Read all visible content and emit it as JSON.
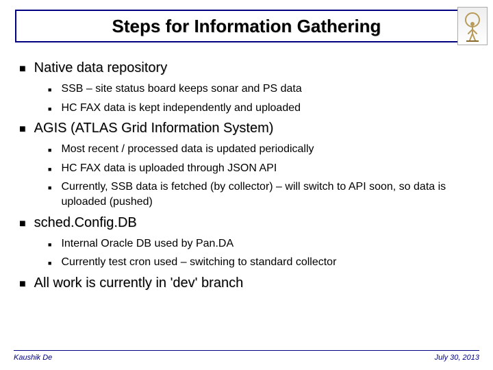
{
  "title": "Steps for Information Gathering",
  "sections": [
    {
      "heading": "Native data repository",
      "items": [
        "SSB – site status board keeps sonar and PS data",
        "HC FAX data is kept independently and uploaded"
      ]
    },
    {
      "heading": "AGIS (ATLAS Grid Information System)",
      "items": [
        "Most recent / processed data is updated periodically",
        "HC FAX data is uploaded through JSON API",
        "Currently, SSB data is fetched (by collector) – will switch to API soon, so data is uploaded (pushed)"
      ]
    },
    {
      "heading": "sched.Config.DB",
      "items": [
        "Internal Oracle DB used by Pan.DA",
        "Currently test cron used – switching to standard collector"
      ]
    },
    {
      "heading": "All work is currently in 'dev' branch",
      "items": []
    }
  ],
  "footer": {
    "author": "Kaushik De",
    "date": "July 30, 2013"
  },
  "logo_name": "atlas-statue"
}
